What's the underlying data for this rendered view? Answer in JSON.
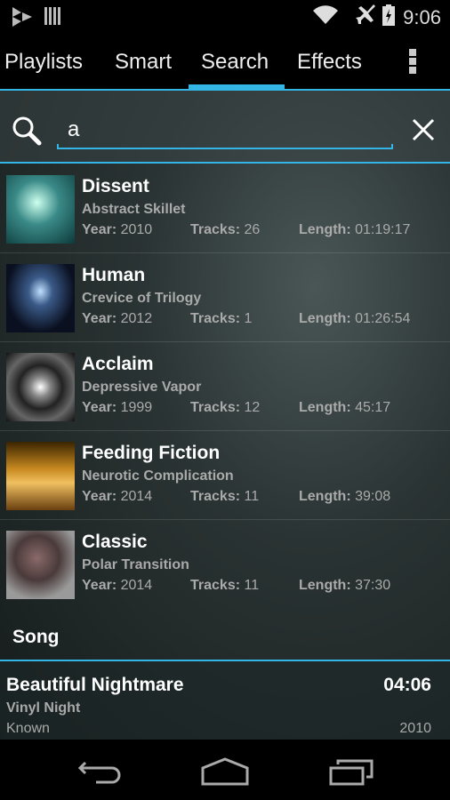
{
  "status": {
    "time": "9:06",
    "icons": [
      "play-store-icon",
      "barcode-icon",
      "wifi-icon",
      "airplane-icon",
      "battery-charging-icon"
    ]
  },
  "tabs": [
    {
      "label": "Playlists"
    },
    {
      "label": "Smart"
    },
    {
      "label": "Search",
      "active": true
    },
    {
      "label": "Effects"
    }
  ],
  "search": {
    "value": "a"
  },
  "labels": {
    "year": "Year:",
    "tracks": "Tracks:",
    "length": "Length:"
  },
  "albums": [
    {
      "title": "Dissent",
      "artist": "Abstract Skillet",
      "year": "2010",
      "tracks": "26",
      "length": "01:19:17"
    },
    {
      "title": "Human",
      "artist": "Crevice of Trilogy",
      "year": "2012",
      "tracks": "1",
      "length": "01:26:54"
    },
    {
      "title": "Acclaim",
      "artist": "Depressive Vapor",
      "year": "1999",
      "tracks": "12",
      "length": "45:17"
    },
    {
      "title": "Feeding Fiction",
      "artist": "Neurotic Complication",
      "year": "2014",
      "tracks": "11",
      "length": "39:08"
    },
    {
      "title": "Classic",
      "artist": "Polar Transition",
      "year": "2014",
      "tracks": "11",
      "length": "37:30"
    }
  ],
  "song_section": {
    "header": "Song",
    "title": "Beautiful Nightmare",
    "artist": "Vinyl Night",
    "album": "Known",
    "duration": "04:06",
    "year": "2010"
  },
  "accent": "#33b5e5"
}
